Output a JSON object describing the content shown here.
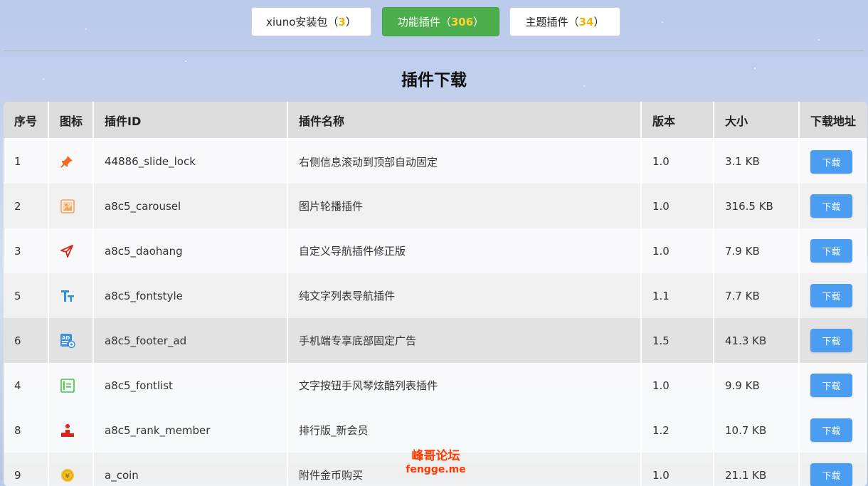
{
  "tabs": [
    {
      "label": "xiuno安装包（",
      "count": "3",
      "suffix": "）",
      "active": false
    },
    {
      "label": "功能插件（",
      "count": "306",
      "suffix": "）",
      "active": true
    },
    {
      "label": "主题插件（",
      "count": "34",
      "suffix": "）",
      "active": false
    }
  ],
  "page_title": "插件下载",
  "table": {
    "headers": {
      "no": "序号",
      "icon": "图标",
      "id": "插件ID",
      "name": "插件名称",
      "version": "版本",
      "size": "大小",
      "download": "下载地址"
    },
    "rows": [
      {
        "no": "1",
        "icon": "pin-icon",
        "id": "44886_slide_lock",
        "name": "右侧信息滚动到顶部自动固定",
        "version": "1.0",
        "size": "3.1 KB",
        "button": "下载"
      },
      {
        "no": "2",
        "icon": "image-carousel-icon",
        "id": "a8c5_carousel",
        "name": "图片轮播插件",
        "version": "1.0",
        "size": "316.5 KB",
        "button": "下载"
      },
      {
        "no": "3",
        "icon": "navigation-arrow-icon",
        "id": "a8c5_daohang",
        "name": "自定义导航插件修正版",
        "version": "1.0",
        "size": "7.9 KB",
        "button": "下载"
      },
      {
        "no": "5",
        "icon": "font-size-icon",
        "id": "a8c5_fontstyle",
        "name": "纯文字列表导航插件",
        "version": "1.1",
        "size": "7.7 KB",
        "button": "下载"
      },
      {
        "no": "6",
        "icon": "ad-settings-icon",
        "id": "a8c5_footer_ad",
        "name": "手机端专享底部固定广告",
        "version": "1.5",
        "size": "41.3 KB",
        "button": "下载"
      },
      {
        "no": "4",
        "icon": "list-box-icon",
        "id": "a8c5_fontlist",
        "name": "文字按钮手风琴炫酷列表插件",
        "version": "1.0",
        "size": "9.9 KB",
        "button": "下载"
      },
      {
        "no": "8",
        "icon": "ranking-podium-icon",
        "id": "a8c5_rank_member",
        "name": "排行版_新会员",
        "version": "1.2",
        "size": "10.7 KB",
        "button": "下载"
      },
      {
        "no": "9",
        "icon": "coin-icon",
        "id": "a_coin",
        "name": "附件金币购买",
        "version": "1.0",
        "size": "21.1 KB",
        "button": "下载"
      }
    ]
  },
  "watermark": {
    "cn": "峰哥论坛",
    "en": "fengge.me"
  },
  "colors": {
    "active_tab": "#4cae4c",
    "count": "#f0b400",
    "button": "#4a9df0",
    "watermark": "#ff3a00"
  }
}
